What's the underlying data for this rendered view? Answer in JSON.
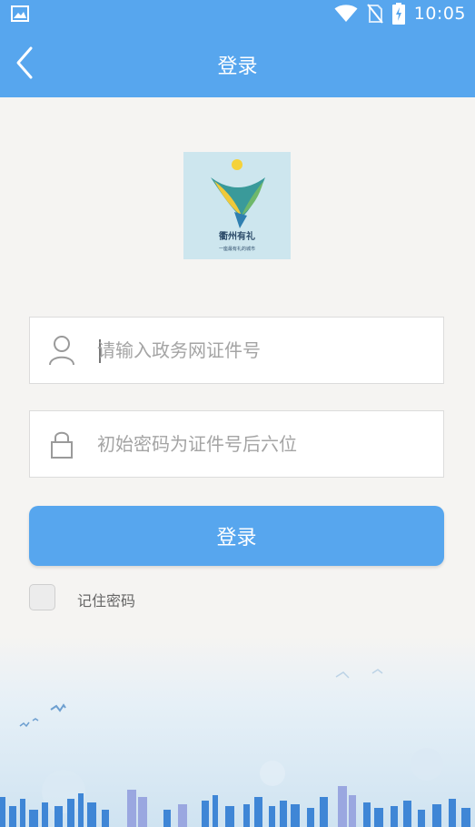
{
  "status_bar": {
    "time": "10:05",
    "icons": [
      "gallery-icon",
      "wifi-icon",
      "no-sim-icon",
      "battery-charging-icon"
    ]
  },
  "app_bar": {
    "title": "登录",
    "back_icon": "chevron-left-icon"
  },
  "logo": {
    "text": "衢州有礼",
    "subtext": "一座最有礼的城市"
  },
  "form": {
    "username": {
      "icon": "user-icon",
      "value": "",
      "placeholder": "请输入政务网证件号"
    },
    "password": {
      "icon": "lock-icon",
      "value": "",
      "placeholder": "初始密码为证件号后六位"
    },
    "login_button": "登录",
    "remember": {
      "label": "记住密码",
      "checked": false
    }
  },
  "colors": {
    "primary": "#57a6ee",
    "background": "#f5f4f2",
    "placeholder": "#a4a4a4"
  }
}
